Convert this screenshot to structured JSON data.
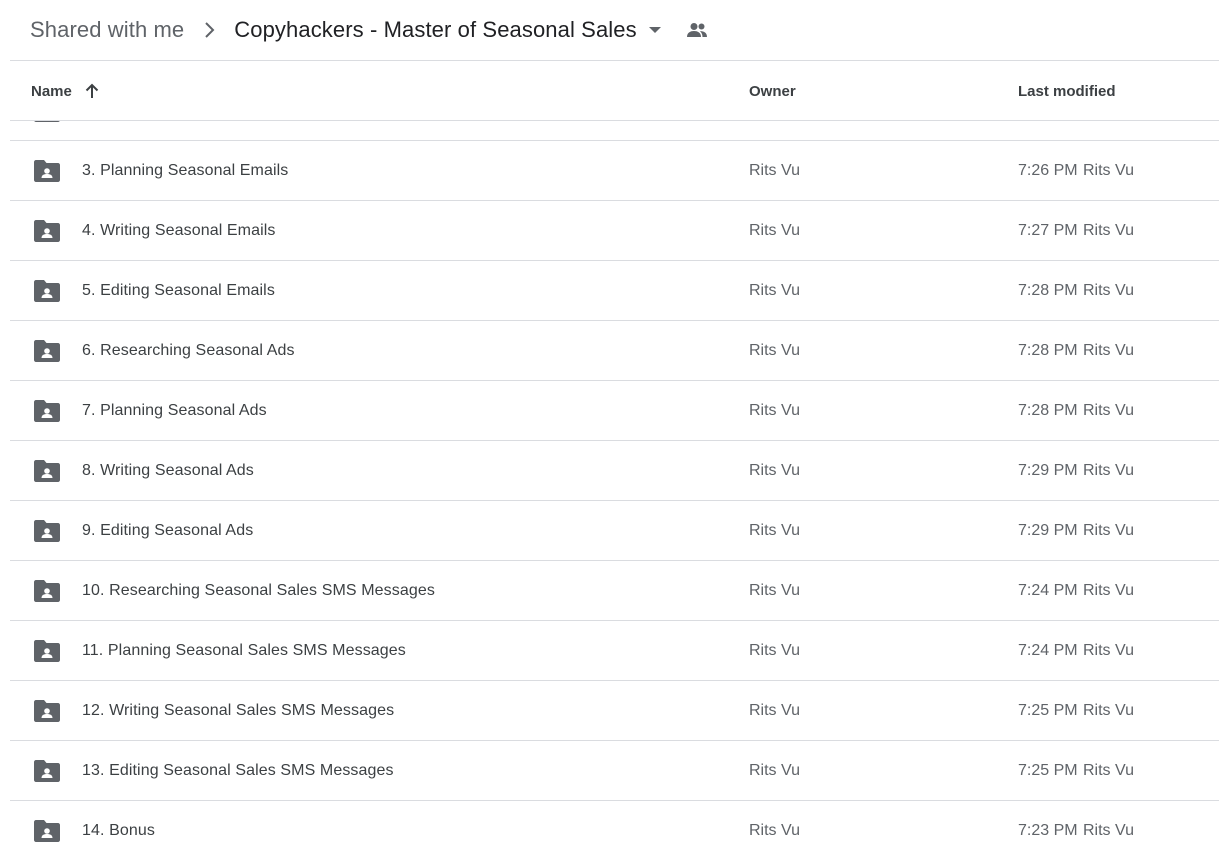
{
  "breadcrumb": {
    "root": "Shared with me",
    "current": "Copyhackers - Master of Seasonal Sales"
  },
  "columns": {
    "name": "Name",
    "owner": "Owner",
    "modified": "Last modified"
  },
  "rows": [
    {
      "name": "",
      "owner": "",
      "time": "",
      "by": ""
    },
    {
      "name": "3. Planning Seasonal Emails",
      "owner": "Rits Vu",
      "time": "7:26 PM",
      "by": "Rits Vu"
    },
    {
      "name": "4. Writing Seasonal Emails",
      "owner": "Rits Vu",
      "time": "7:27 PM",
      "by": "Rits Vu"
    },
    {
      "name": "5. Editing Seasonal Emails",
      "owner": "Rits Vu",
      "time": "7:28 PM",
      "by": "Rits Vu"
    },
    {
      "name": "6. Researching Seasonal Ads",
      "owner": "Rits Vu",
      "time": "7:28 PM",
      "by": "Rits Vu"
    },
    {
      "name": "7. Planning Seasonal Ads",
      "owner": "Rits Vu",
      "time": "7:28 PM",
      "by": "Rits Vu"
    },
    {
      "name": "8. Writing Seasonal Ads",
      "owner": "Rits Vu",
      "time": "7:29 PM",
      "by": "Rits Vu"
    },
    {
      "name": "9. Editing Seasonal Ads",
      "owner": "Rits Vu",
      "time": "7:29 PM",
      "by": "Rits Vu"
    },
    {
      "name": "10. Researching Seasonal Sales SMS Messages",
      "owner": "Rits Vu",
      "time": "7:24 PM",
      "by": "Rits Vu"
    },
    {
      "name": "11. Planning Seasonal Sales SMS Messages",
      "owner": "Rits Vu",
      "time": "7:24 PM",
      "by": "Rits Vu"
    },
    {
      "name": "12. Writing Seasonal Sales SMS Messages",
      "owner": "Rits Vu",
      "time": "7:25 PM",
      "by": "Rits Vu"
    },
    {
      "name": "13. Editing Seasonal Sales SMS Messages",
      "owner": "Rits Vu",
      "time": "7:25 PM",
      "by": "Rits Vu"
    },
    {
      "name": "14. Bonus",
      "owner": "Rits Vu",
      "time": "7:23 PM",
      "by": "Rits Vu"
    }
  ],
  "icons": {
    "separator": "chevron-right-icon",
    "dropdown": "arrow-drop-down-icon",
    "shared": "people-icon",
    "sort": "arrow-upward-icon",
    "row": "shared-folder-icon"
  },
  "colors": {
    "icon": "#5f6368",
    "divider": "#dadce0"
  }
}
